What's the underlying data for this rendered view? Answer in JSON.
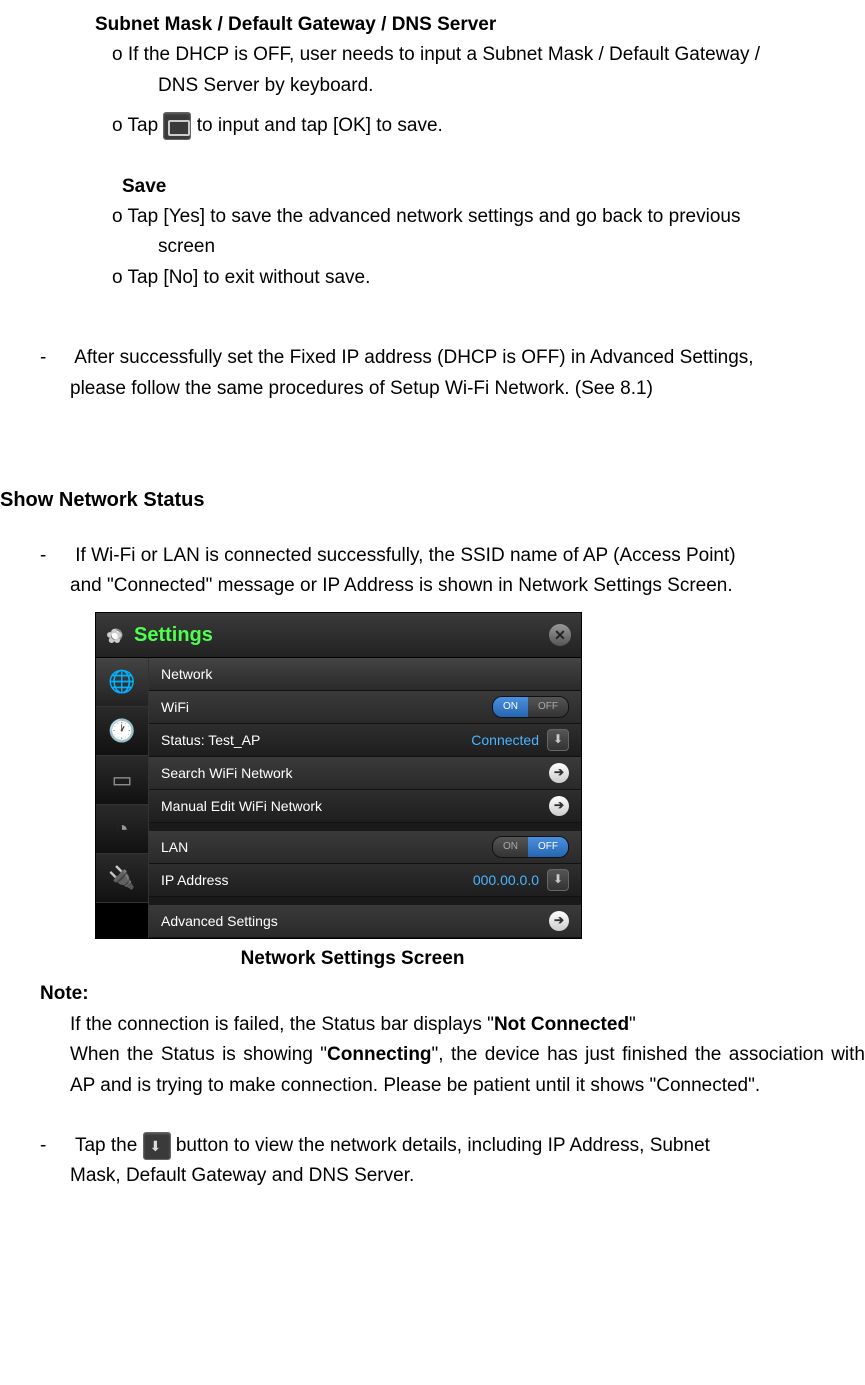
{
  "section1": {
    "title": "Subnet Mask / Default Gateway / DNS Server",
    "item1a": "o If the DHCP is OFF, user needs to input a Subnet Mask / Default Gateway /",
    "item1b": "DNS Server by keyboard.",
    "item2a": "o Tap ",
    "item2b": " to input and tap [OK] to save."
  },
  "section2": {
    "title": "Save",
    "item1a": "o Tap [Yes] to save the advanced network settings and go back to previous",
    "item1b": "screen",
    "item2": "o Tap [No] to exit without save."
  },
  "dash1": {
    "prefix": "-",
    "line1": "After successfully set the Fixed IP address (DHCP is OFF) in Advanced Settings,",
    "line2": "please follow the same procedures of Setup Wi-Fi Network. (See 8.1)"
  },
  "heading": "Show Network Status",
  "dash2": {
    "prefix": "-",
    "line1": "If Wi-Fi or LAN is connected successfully, the SSID name of AP (Access Point)",
    "line2": "and \"Connected\" message or IP Address is shown in Network Settings Screen."
  },
  "settings": {
    "title": "Settings",
    "network": "Network",
    "wifi": "WiFi",
    "on": "ON",
    "off": "OFF",
    "status_label": "Status: Test_AP",
    "status_value": "Connected",
    "search_wifi": "Search WiFi Network",
    "manual_edit": "Manual Edit WiFi Network",
    "lan": "LAN",
    "ip_address": "IP Address",
    "ip_value": "000.00.0.0",
    "advanced": "Advanced Settings"
  },
  "caption": "Network Settings Screen",
  "note": {
    "title": "Note:",
    "line1a": "If the connection is failed, the Status bar displays \"",
    "line1b": "Not Connected",
    "line1c": "\"",
    "line2a": "When the Status is showing \"",
    "line2b": "Connecting",
    "line2c": "\", the device has just finished the association with AP and is trying to make connection. Please be patient until it shows \"Connected\"."
  },
  "dash3": {
    "prefix": "-",
    "line1a": "Tap the ",
    "line1b": " button to view the network details, including IP Address, Subnet",
    "line2": "Mask, Default Gateway and DNS Server."
  }
}
